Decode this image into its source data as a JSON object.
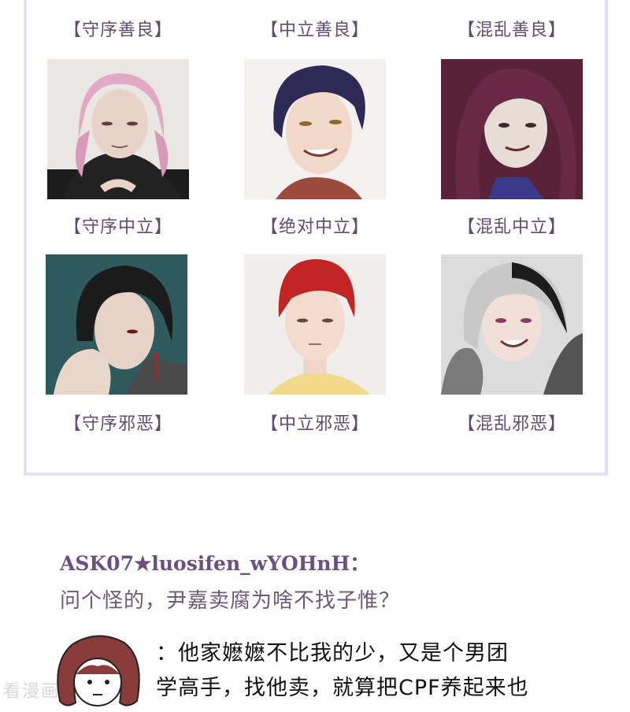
{
  "alignment_grid": {
    "row1_labels": [
      "【守序善良】",
      "【中立善良】",
      "【混乱善良】"
    ],
    "row2_labels": [
      "【守序中立】",
      "【绝对中立】",
      "【混乱中立】"
    ],
    "row3_labels": [
      "【守序邪恶】",
      "【中立邪恶】",
      "【混乱邪恶】"
    ]
  },
  "ask": {
    "title": "ASK07★luosifen_wYOHnH：",
    "question": "问个怪的，尹嘉卖腐为啥不找子惟？",
    "answer_line1": "：他家嬷嬷不比我的少，又是个男团",
    "answer_line2": "学高手，找他卖，就算把CPF养起来也"
  },
  "watermark": "看漫画",
  "colors": {
    "label_purple": "#5e4c72",
    "title_purple": "#6b4f7f",
    "frame_border": "#e4e0f0"
  }
}
